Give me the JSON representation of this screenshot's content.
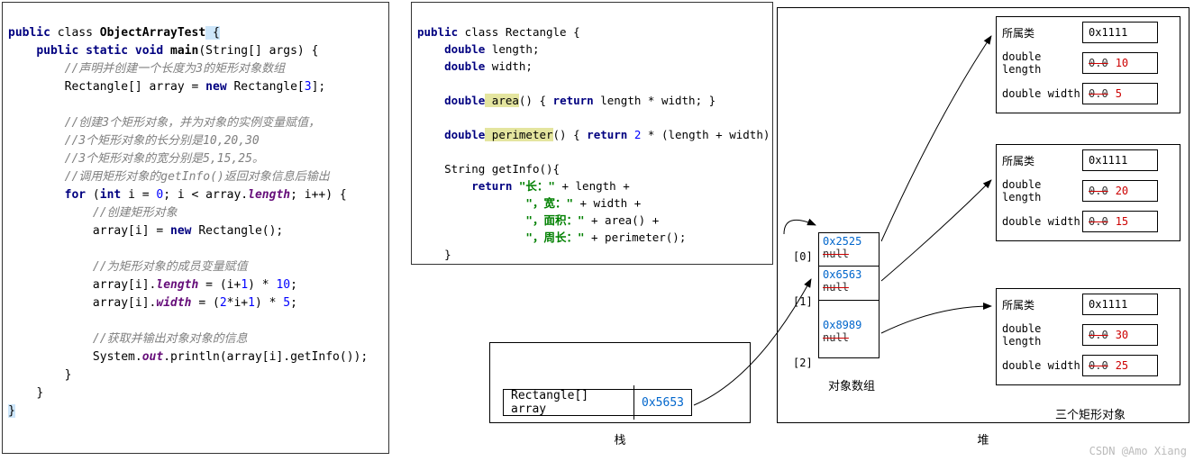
{
  "code_left": {
    "l1_p1": "public",
    "l1_p2": " class ",
    "l1_cls": "ObjectArrayTest",
    "l1_br": " {",
    "l2_p1": "public static",
    "l2_p2": " void ",
    "l2_m": "main",
    "l2_sig": "(String[] args) {",
    "l3": "//声明并创建一个长度为3的矩形对象数组",
    "l4_p1": "Rectangle[] array = ",
    "l4_kw": "new",
    "l4_p2": " Rectangle[",
    "l4_n": "3",
    "l4_p3": "];",
    "l6": "//创建3个矩形对象，并为对象的实例变量赋值，",
    "l7": "//3个矩形对象的长分别是10,20,30",
    "l8": "//3个矩形对象的宽分别是5,15,25。",
    "l9": "//调用矩形对象的getInfo()返回对象信息后输出",
    "l10_for": "for",
    "l10_a": " (",
    "l10_int": "int",
    "l10_b": " i = ",
    "l10_z": "0",
    "l10_c": "; i < array.",
    "l10_len": "length",
    "l10_d": "; i++) {",
    "l11": "//创建矩形对象",
    "l12_a": "array[i] = ",
    "l12_kw": "new",
    "l12_b": " Rectangle();",
    "l14": "//为矩形对象的成员变量赋值",
    "l15_a": "array[i].",
    "l15_f": "length",
    "l15_b": " = (i+",
    "l15_n": "1",
    "l15_c": ") * ",
    "l15_n2": "10",
    "l15_d": ";",
    "l16_a": "array[i].",
    "l16_f": "width",
    "l16_b": " = (",
    "l16_n": "2",
    "l16_c": "*i+",
    "l16_n2": "1",
    "l16_d": ") * ",
    "l16_n3": "5",
    "l16_e": ";",
    "l18": "//获取并输出对象对象的信息",
    "l19_a": "System.",
    "l19_out": "out",
    "l19_b": ".println(array[i].getInfo());",
    "l20": "}",
    "l21": "}",
    "l22": "}"
  },
  "code_right": {
    "l1_p1": "public",
    "l1_p2": " class Rectangle {",
    "l2_kw": "double",
    "l2_b": " length;",
    "l3_kw": "double",
    "l3_b": " width;",
    "l5_kw": "double",
    "l5_m": " area",
    "l5_b": "() { ",
    "l5_ret": "return",
    "l5_c": " length * width; }",
    "l7_kw": "double",
    "l7_m": " perimeter",
    "l7_b": "() { ",
    "l7_ret": "return",
    "l7_c": " ",
    "l7_n": "2",
    "l7_d": " * (length + width); }",
    "l9_a": "String getInfo(){",
    "l10_ret": "return",
    "l10_s": " \"长：\" ",
    "l10_b": "+ length +",
    "l11_s": "\"，宽：\" ",
    "l11_b": "+ width +",
    "l12_s": "\"，面积：\" ",
    "l12_b": "+ area() +",
    "l13_s": "\"，周长：\" ",
    "l13_b": "+ perimeter();",
    "l14": "}",
    "l15": "}"
  },
  "stack": {
    "label": "Rectangle[]  array",
    "addr": "0x5653",
    "caption": "栈"
  },
  "heap": {
    "caption": "堆",
    "array_label": "对象数组",
    "objs_label": "三个矩形对象",
    "slots": [
      {
        "idx": "[0]",
        "addr": "0x2525",
        "null": "null"
      },
      {
        "idx": "[1]",
        "addr": "0x6563",
        "null": "null"
      },
      {
        "idx": "[2]",
        "addr": "0x8989",
        "null": "null"
      }
    ],
    "objects": [
      {
        "class_label": "所属类",
        "class_addr": "0x1111",
        "len_label": "double length",
        "len_old": "0.0",
        "len_new": "10",
        "wid_label": "double width",
        "wid_old": "0.0",
        "wid_new": "5"
      },
      {
        "class_label": "所属类",
        "class_addr": "0x1111",
        "len_label": "double length",
        "len_old": "0.0",
        "len_new": "20",
        "wid_label": "double width",
        "wid_old": "0.0",
        "wid_new": "15"
      },
      {
        "class_label": "所属类",
        "class_addr": "0x1111",
        "len_label": "double length",
        "len_old": "0.0",
        "len_new": "30",
        "wid_label": "double width",
        "wid_old": "0.0",
        "wid_new": "25"
      }
    ]
  },
  "watermark": "CSDN @Amo Xiang"
}
